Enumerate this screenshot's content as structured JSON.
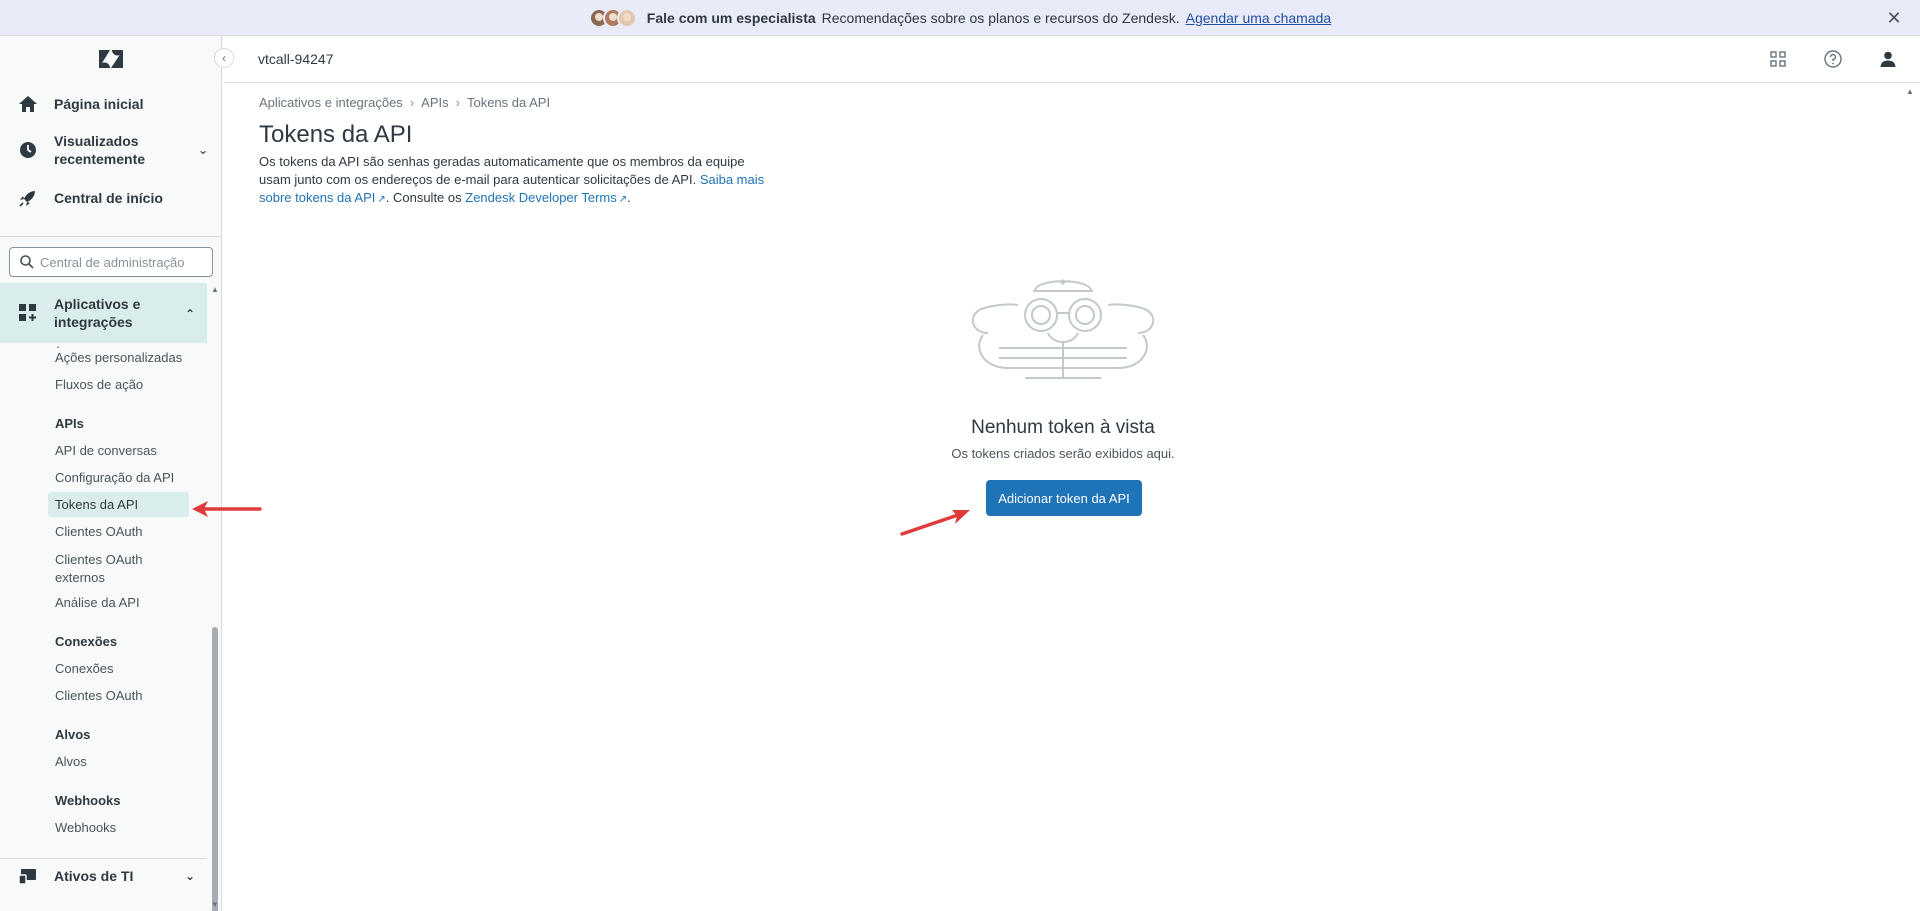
{
  "banner": {
    "strong": "Fale com um especialista",
    "text": "Recomendações sobre os planos e recursos do Zendesk.",
    "link": "Agendar uma chamada"
  },
  "topbar": {
    "account": "vtcall-94247"
  },
  "sidebar": {
    "nav": [
      {
        "label": "Página inicial",
        "icon": "home-icon"
      },
      {
        "label": "Visualizados recentemente",
        "icon": "clock-icon"
      },
      {
        "label": "Central de início",
        "icon": "rocket-icon"
      }
    ],
    "search_placeholder": "Central de administração",
    "apps_label": "Aplicativos e integrações",
    "subnav": {
      "custom_actions": "Ações personalizadas",
      "action_flows": "Fluxos de ação",
      "apis_head": "APIs",
      "conversations_api": "API de conversas",
      "api_config": "Configuração da API",
      "api_tokens": "Tokens da API",
      "oauth_clients": "Clientes OAuth",
      "external_oauth_clients": "Clientes OAuth externos",
      "api_analysis": "Análise da API",
      "connections_head": "Conexões",
      "connections": "Conexões",
      "oauth_clients_2": "Clientes OAuth",
      "targets_head": "Alvos",
      "targets": "Alvos",
      "webhooks_head": "Webhooks",
      "webhooks": "Webhooks"
    },
    "it_assets": "Ativos de TI"
  },
  "main": {
    "breadcrumb": [
      "Aplicativos e integrações",
      "APIs",
      "Tokens da API"
    ],
    "title": "Tokens da API",
    "desc_1": "Os tokens da API são senhas geradas automaticamente que os membros da equipe usam junto com os endereços de e-mail para autenticar solicitações de API.",
    "desc_link_1": "Saiba mais sobre tokens da API",
    "desc_2": ". Consulte os",
    "desc_link_2": "Zendesk Developer Terms",
    "desc_3": ".",
    "empty_title": "Nenhum token à vista",
    "empty_sub": "Os tokens criados serão exibidos aqui.",
    "add_button": "Adicionar token da API"
  },
  "colors": {
    "accent": "#1f73b7",
    "active_bg": "#d9eeec",
    "annotation_arrow": "#e03b3b"
  }
}
